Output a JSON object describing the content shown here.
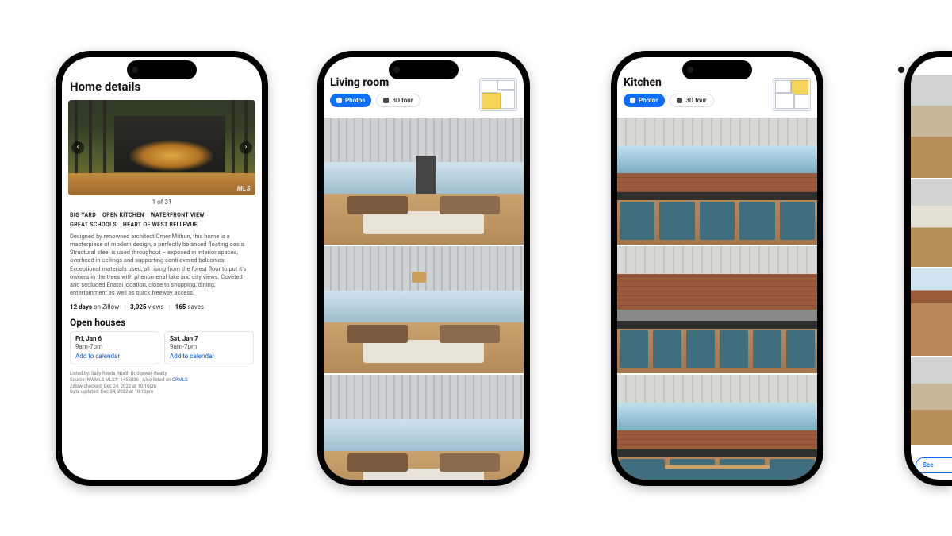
{
  "phone1": {
    "title": "Home details",
    "hero": {
      "mls_badge": "MLS",
      "counter": "1 of 31",
      "prev_glyph": "‹",
      "next_glyph": "›"
    },
    "tags": [
      "BIG YARD",
      "OPEN KITCHEN",
      "WATERFRONT VIEW",
      "GREAT SCHOOLS",
      "HEART OF WEST BELLEVUE"
    ],
    "description": "Designed by renowned architect Omer Mithun, this home is a masterpiece of modern design, a perfectly balanced floating oasis. Structural steel is used throughout – exposed in interior spaces, overhead in ceilings and supporting cantilevered balconies. Exceptional materials used, all rising from the forest floor to put it's owners in the trees with phenomenal lake and city views. Coveted and secluded Enatai location, close to shopping, dining, entertainment as well as quick freeway access.",
    "stats": {
      "days_num": "12",
      "days_suffix": "days",
      "days_tail": "on Zillow",
      "views_num": "3,025",
      "views_label": "views",
      "saves_num": "165",
      "saves_label": "saves"
    },
    "open_houses_title": "Open houses",
    "open_houses": [
      {
        "day": "Fri, Jan 6",
        "time": "9am-7pm",
        "link": "Add to calendar"
      },
      {
        "day": "Sat, Jan 7",
        "time": "9am-7pm",
        "link": "Add to calendar"
      }
    ],
    "fineprint": {
      "listed": "Listed by: Sally Reeds, North Bridgeway Realty",
      "source_a": "Source: NWMLS  MLS#: 1456036",
      "source_b": "Also listed on ",
      "source_link": "CRMLS",
      "checked": "Zillow checked: Dec 24, 2022 at 10:10pm",
      "updated": "Data updated: Dec 24, 2022 at 10:10pm"
    }
  },
  "phone2": {
    "title": "Living room",
    "pills": {
      "photos": "Photos",
      "tour": "3D tour"
    }
  },
  "phone3": {
    "title": "Kitchen",
    "pills": {
      "photos": "Photos",
      "tour": "3D tour"
    }
  },
  "phone4": {
    "button": "See"
  }
}
